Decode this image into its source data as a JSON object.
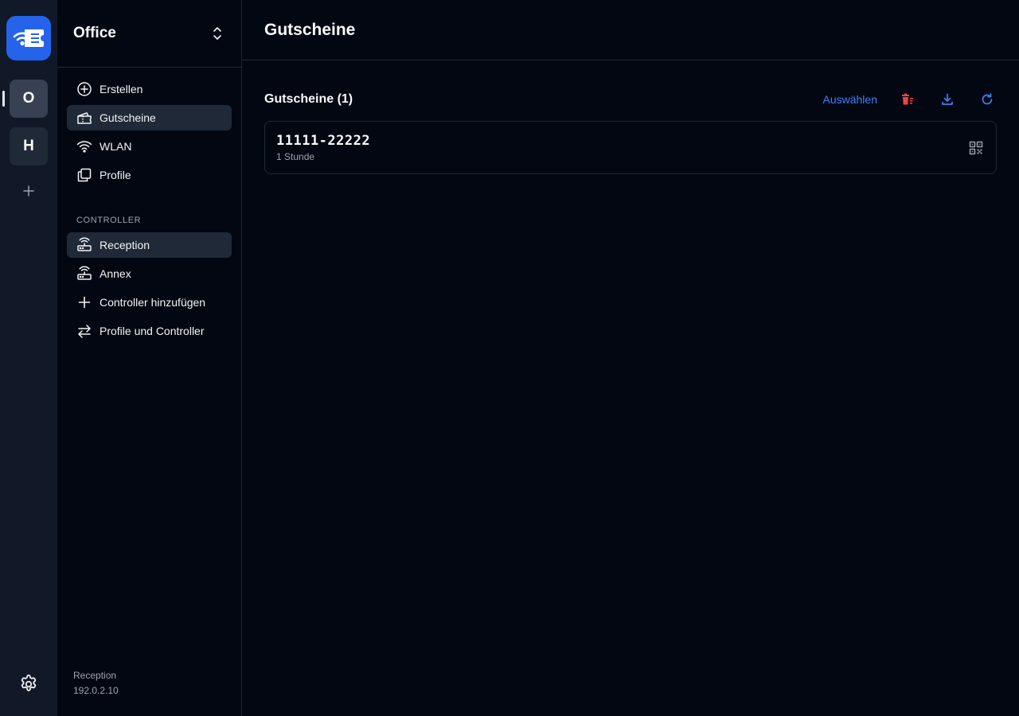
{
  "rail": {
    "workspaces": [
      {
        "letter": "O"
      },
      {
        "letter": "H"
      }
    ],
    "icons": {
      "logo": "wifi-ticket-icon",
      "add": "plus-icon",
      "settings": "gear-icon"
    }
  },
  "sidebar": {
    "title": "Office",
    "items": [
      {
        "label": "Erstellen",
        "icon": "plus-circle-icon"
      },
      {
        "label": "Gutscheine",
        "icon": "ticket-icon"
      },
      {
        "label": "WLAN",
        "icon": "wifi-icon"
      },
      {
        "label": "Profile",
        "icon": "copy-icon"
      }
    ],
    "controller_section_label": "CONTROLLER",
    "controllers": [
      {
        "label": "Reception",
        "icon": "router-icon"
      },
      {
        "label": "Annex",
        "icon": "router-icon"
      },
      {
        "label": "Controller hinzufügen",
        "icon": "plus-icon"
      },
      {
        "label": "Profile und Controller",
        "icon": "arrows-swap-icon"
      }
    ],
    "footer": {
      "controller_name": "Reception",
      "controller_ip": "192.0.2.10"
    }
  },
  "main": {
    "page_title": "Gutscheine",
    "section_title": "Gutscheine (1)",
    "select_label": "Auswählen",
    "vouchers": [
      {
        "code": "11111-22222",
        "duration": "1 Stunde"
      }
    ]
  },
  "colors": {
    "accent": "#3b82f6",
    "danger": "#ef4444",
    "background": "#030712",
    "rail": "#111827"
  }
}
